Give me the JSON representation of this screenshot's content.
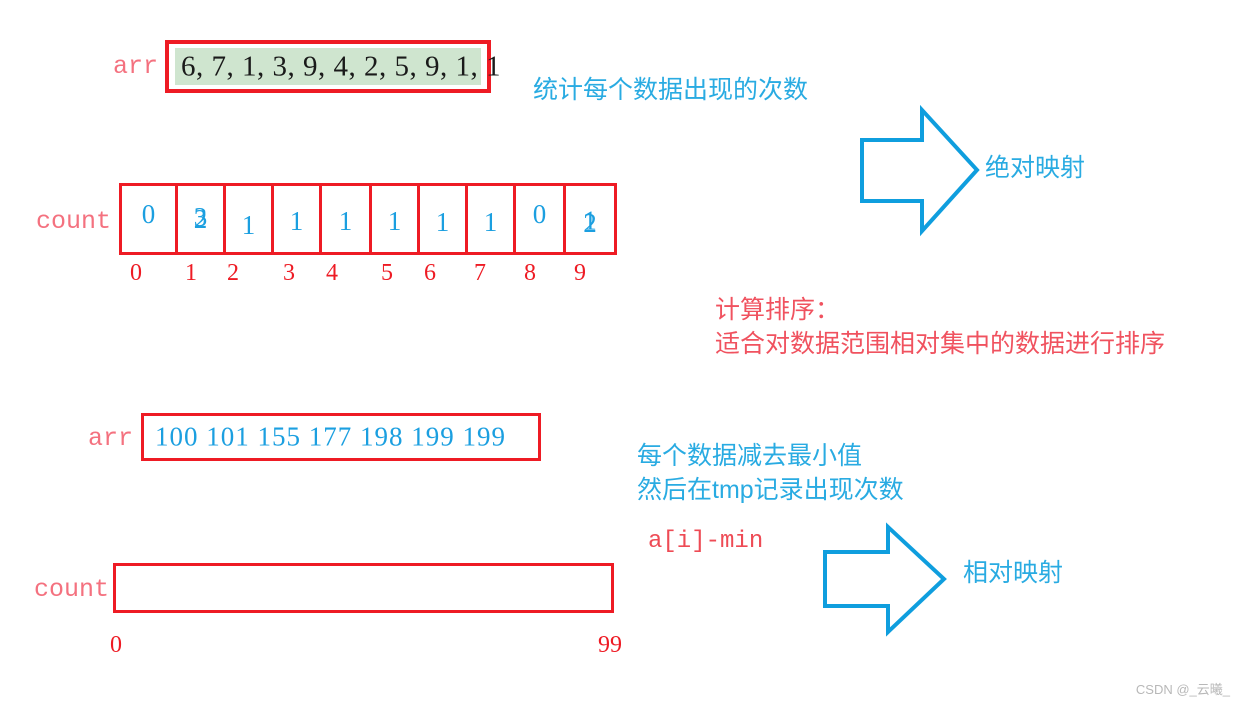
{
  "diagram": {
    "title_watermark": "CSDN @_云曦_",
    "arr_label": "arr",
    "count_label": "count",
    "top_array": {
      "label": "arr",
      "values_text": "6, 7, 1, 3, 9, 4, 2, 5, 9, 1, 1",
      "values": [
        6,
        7,
        1,
        3,
        9,
        4,
        2,
        5,
        9,
        1,
        1
      ],
      "highlight_color": "#cfe5cf",
      "border_color": "#ee1b24"
    },
    "count_array": {
      "label": "count",
      "cells": [
        {
          "value": "0",
          "index": "0",
          "overwritten": false
        },
        {
          "value": "3",
          "overlay": "2",
          "index": "1",
          "overwritten": true
        },
        {
          "value": "1",
          "index": "2",
          "overwritten": false
        },
        {
          "value": "1",
          "index": "3",
          "overwritten": false
        },
        {
          "value": "1",
          "index": "4",
          "overwritten": false
        },
        {
          "value": "1",
          "index": "5",
          "overwritten": false
        },
        {
          "value": "1",
          "index": "6",
          "overwritten": false
        },
        {
          "value": "1",
          "index": "7",
          "overwritten": false
        },
        {
          "value": "0",
          "index": "8",
          "overwritten": false
        },
        {
          "value": "2",
          "overlay": "1",
          "index": "9",
          "overwritten": true
        }
      ],
      "indices": [
        "0",
        "1",
        "2",
        "3",
        "4",
        "5",
        "6",
        "7",
        "8",
        "9"
      ],
      "value_color": "#1b9fe0",
      "index_color": "#ee1b24"
    },
    "second_array": {
      "label": "arr",
      "values": [
        "100",
        "101",
        "155",
        "177",
        "198",
        "199",
        "199"
      ],
      "values_text": "100  101  155  177  198  199  199",
      "value_color": "#1b9fe0"
    },
    "bottom_count": {
      "label": "count",
      "range_start": "0",
      "range_end": "99"
    },
    "annotations": {
      "count_occurrences": "统计每个数据出现的次数",
      "absolute_mapping": "绝对映射",
      "counting_sort_title": "计算排序：",
      "counting_sort_desc": "适合对数据范围相对集中的数据进行排序",
      "subtract_min_line1": "每个数据减去最小值",
      "subtract_min_line2": "然后在tmp记录出现次数",
      "formula": "a[i]-min",
      "relative_mapping": "相对映射"
    },
    "colors": {
      "red": "#ee1b24",
      "light_red": "#f4717f",
      "blue": "#29abe2",
      "value_blue": "#1b9fe0",
      "green_highlight": "#cfe5cf",
      "text_red": "#f0525f"
    }
  }
}
